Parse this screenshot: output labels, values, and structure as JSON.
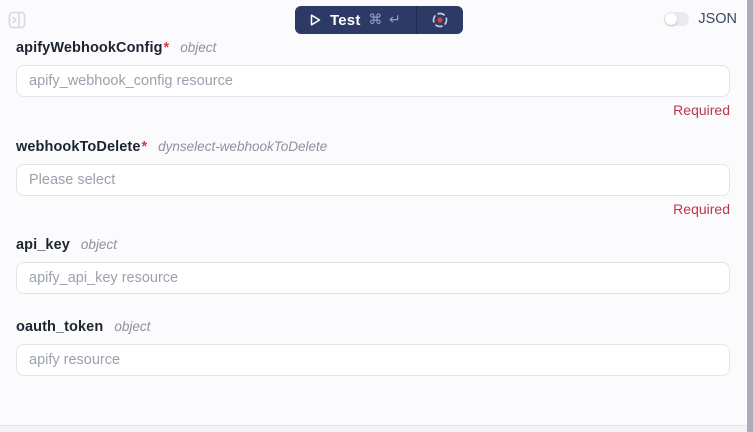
{
  "header": {
    "test_button": {
      "label": "Test",
      "shortcut": "⌘ ↵"
    },
    "json_toggle": {
      "label": "JSON",
      "state": "off"
    }
  },
  "icons": {
    "panel_toggle": "panel-right-expand-icon",
    "play": "play-icon",
    "focus": "focus-target-icon"
  },
  "colors": {
    "button_navy": "#2d3a66",
    "required_red": "#b8384a",
    "asterisk_red": "#d63649",
    "focus_dot_red": "#d6453a",
    "page_background": "#fbfbfd"
  },
  "fields": [
    {
      "name": "apifyWebhookConfig",
      "required_marker": "*",
      "meta": "object",
      "placeholder": "apify_webhook_config resource",
      "validation": "Required"
    },
    {
      "name": "webhookToDelete",
      "required_marker": "*",
      "meta": "dynselect-webhookToDelete",
      "placeholder": "Please select",
      "validation": "Required"
    },
    {
      "name": "api_key",
      "required_marker": "",
      "meta": "object",
      "placeholder": "apify_api_key resource",
      "validation": ""
    },
    {
      "name": "oauth_token",
      "required_marker": "",
      "meta": "object",
      "placeholder": "apify resource",
      "validation": ""
    }
  ]
}
